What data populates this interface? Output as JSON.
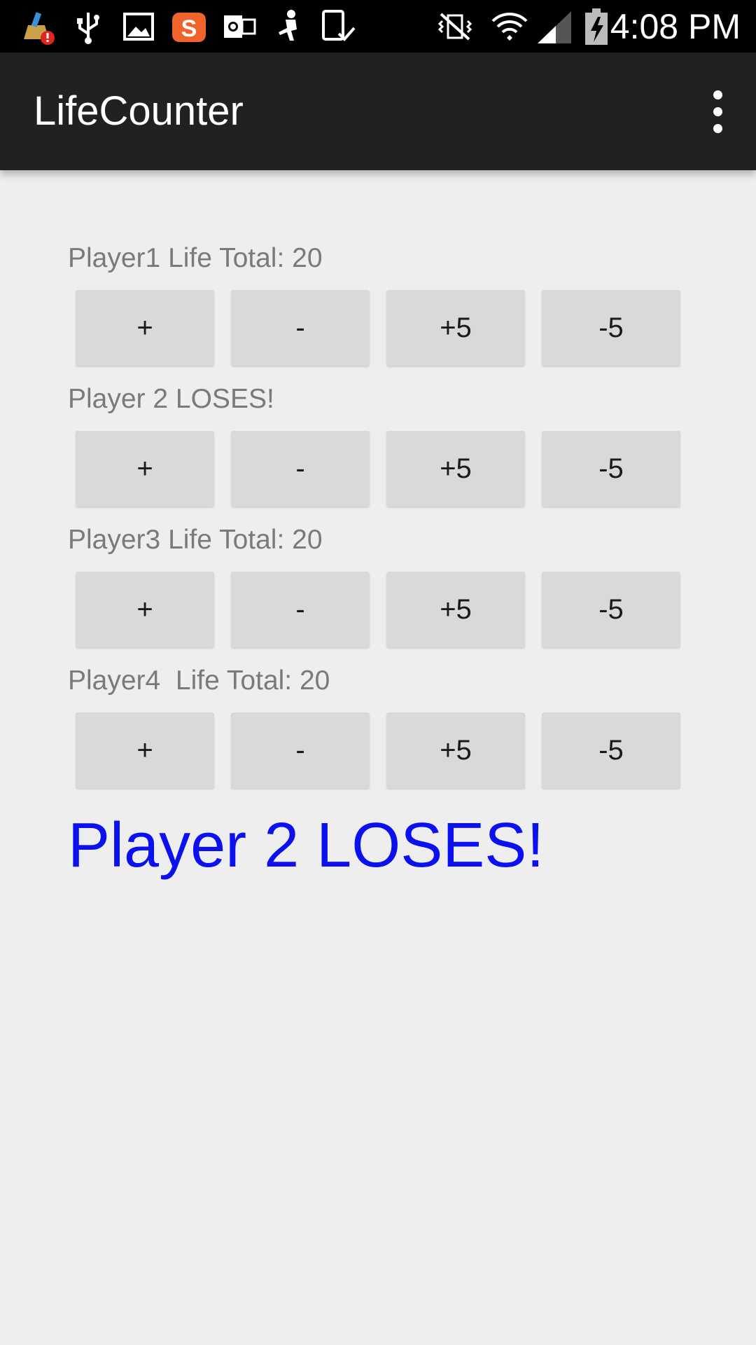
{
  "status_bar": {
    "time": "4:08 PM",
    "icons": [
      "cleaner-alert-icon",
      "usb-icon",
      "image-icon",
      "sogou-s-icon",
      "outlook-icon",
      "figure-icon",
      "tablet-check-icon",
      "vibrate-mute-icon",
      "wifi-icon",
      "signal-icon",
      "battery-charging-icon"
    ]
  },
  "action_bar": {
    "title": "LifeCounter",
    "overflow_icon": "more-vertical-icon"
  },
  "players": [
    {
      "label": "Player1 Life Total: 20",
      "buttons": [
        "+",
        "-",
        "+5",
        "-5"
      ]
    },
    {
      "label": "Player 2 LOSES!",
      "buttons": [
        "+",
        "-",
        "+5",
        "-5"
      ]
    },
    {
      "label": "Player3 Life Total: 20",
      "buttons": [
        "+",
        "-",
        "+5",
        "-5"
      ]
    },
    {
      "label": "Player4  Life Total: 20",
      "buttons": [
        "+",
        "-",
        "+5",
        "-5"
      ]
    }
  ],
  "result": {
    "text": "Player 2 LOSES!",
    "color": "#0a10f0"
  }
}
